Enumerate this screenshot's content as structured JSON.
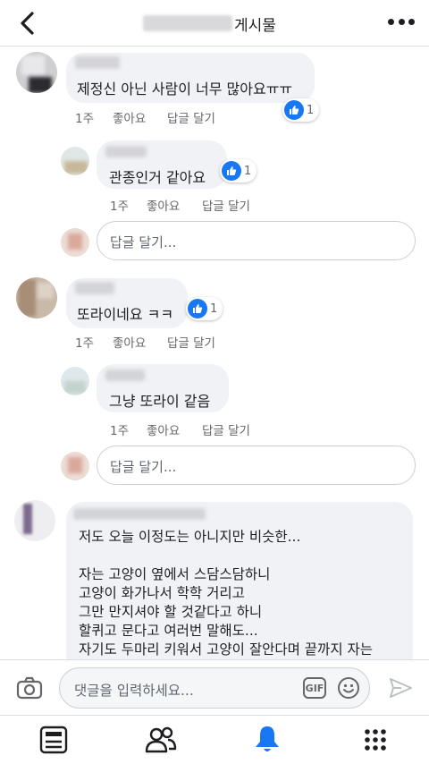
{
  "header": {
    "title_suffix": "게시물"
  },
  "comments": [
    {
      "text": "제정신 아닌 사람이 너무 많아요ㅠㅠ",
      "time": "1주",
      "like_label": "좋아요",
      "reply_label": "답글 달기",
      "reactions": "1",
      "replies": [
        {
          "text": "관종인거 같아요",
          "time": "1주",
          "like_label": "좋아요",
          "reply_label": "답글 달기",
          "reactions": "1"
        }
      ],
      "reply_placeholder": "답글 달기..."
    },
    {
      "text": "또라이네요 ㅋㅋ",
      "time": "1주",
      "like_label": "좋아요",
      "reply_label": "답글 달기",
      "reactions": "1",
      "replies": [
        {
          "text": "그냥 또라이 같음",
          "time": "1주",
          "like_label": "좋아요",
          "reply_label": "답글 달기"
        }
      ],
      "reply_placeholder": "답글 달기..."
    },
    {
      "text": "저도 오늘 이정도는 아니지만 비슷한...\n\n자는 고양이 옆에서 스담스담하니\n고양이 화가나서 학학 거리고\n그만 만지셔야 할 것같다고 하니\n할퀴고 문다고 여러번 말해도...\n자기도 두마리 키워서 고양이 잘안다며 끝까지 자는\n애 만지더니"
    }
  ],
  "composer": {
    "placeholder": "댓글을 입력하세요...",
    "gif_label": "GIF"
  },
  "icons": {
    "back": "chevron-left-icon",
    "more": "more-dots-icon",
    "like": "thumbs-up-icon",
    "camera": "camera-icon",
    "emoji": "smiley-icon",
    "send": "send-icon",
    "tabs": [
      "news-feed-icon",
      "friends-icon",
      "notifications-bell-icon",
      "menu-grid-icon"
    ]
  },
  "colors": {
    "accent": "#1877f2",
    "bubble": "#f0f2f5",
    "meta_text": "#65676b",
    "divider": "#dadde1"
  }
}
